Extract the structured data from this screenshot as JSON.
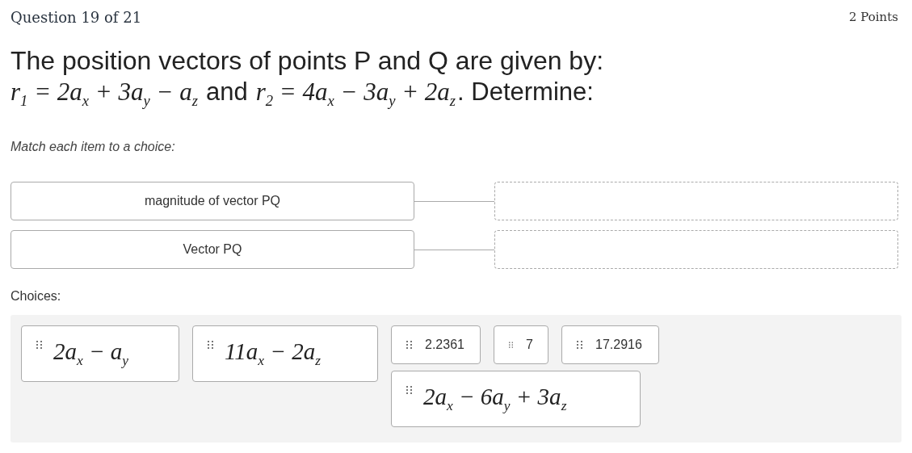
{
  "header": {
    "question": "Question 19 of 21",
    "points": "2 Points"
  },
  "prompt": {
    "line_1": "The position vectors of points P and Q are given by:",
    "line_2": [
      {
        "kind": "math",
        "text": "r$_{1}$ = 2a$_{x}$ + 3a$_{y}$ − a$_{z}$"
      },
      {
        "kind": "text",
        "text": "and"
      },
      {
        "kind": "math",
        "text": "r$_{2}$ = 4a$_{x}$ − 3a$_{y}$ + 2a$_{z}$"
      },
      {
        "kind": "text",
        "text": ". Determine:"
      }
    ]
  },
  "instruction": "Match each item to a choice:",
  "items": [
    {
      "label": "magnitude of vector PQ"
    },
    {
      "label": "Vector PQ"
    }
  ],
  "choices_label": "Choices:",
  "choices": [
    {
      "kind": "math",
      "text": "2a$_{x}$ − a$_{y}$"
    },
    {
      "kind": "math",
      "text": "11a$_{x}$ − 2a$_{z}$"
    },
    {
      "kind": "text",
      "text": "2.2361"
    },
    {
      "kind": "text",
      "text": "7"
    },
    {
      "kind": "text",
      "text": "17.2916"
    },
    {
      "kind": "math",
      "text": "2a$_{x}$ − 6a$_{y}$ + 3a$_{z}$"
    }
  ]
}
